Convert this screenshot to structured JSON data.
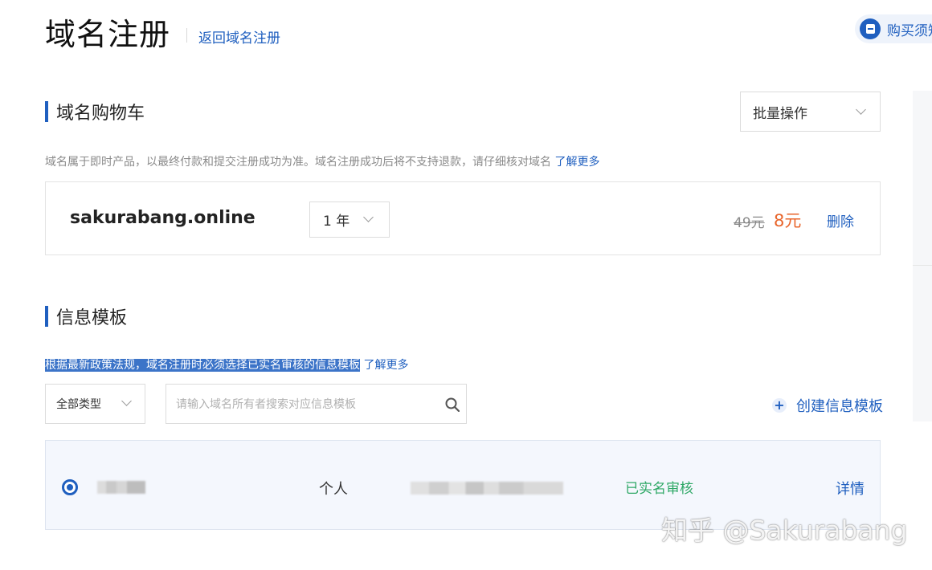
{
  "header": {
    "title": "域名注册",
    "back_link": "返回域名注册",
    "buy_notice": "购买须知"
  },
  "cart": {
    "heading": "域名购物车",
    "batch_select": "批量操作",
    "tip": "域名属于即时产品，以最终付款和提交注册成功为准。域名注册成功后将不支持退款，请仔细核对域名",
    "tip_link": "了解更多",
    "item": {
      "domain": "sakurabang.online",
      "period": "1 年",
      "old_price": "49元",
      "new_price": "8元",
      "delete": "删除"
    }
  },
  "templates": {
    "heading": "信息模板",
    "tip_highlight": "根据最新政策法规，域名注册时必须选择已实名审核的信息模板",
    "tip_link": "了解更多",
    "type_select": "全部类型",
    "search_placeholder": "请输入域名所有者搜索对应信息模板",
    "create": "创建信息模板",
    "rows": [
      {
        "type": "个人",
        "status": "已实名审核",
        "detail": "详情"
      }
    ]
  },
  "watermark": "知乎 @Sakurabang",
  "colors": {
    "accent": "#1f5fbf",
    "price": "#e8642a",
    "verified": "#2ea866"
  },
  "icons": [
    "file-icon",
    "chevron-down-icon",
    "search-icon",
    "plus-icon",
    "radio-selected-icon"
  ]
}
